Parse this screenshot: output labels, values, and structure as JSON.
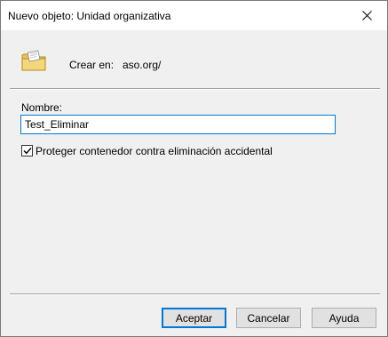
{
  "window": {
    "title": "Nuevo objeto: Unidad organizativa",
    "close_icon": "close-icon"
  },
  "create": {
    "label": "Crear en:",
    "path": "aso.org/",
    "icon": "organizational-unit-folder-icon"
  },
  "form": {
    "name_label": "Nombre:",
    "name_value": "Test_Eliminar",
    "protect_checkbox": {
      "label": "Proteger contenedor contra eliminación accidental",
      "checked": true
    }
  },
  "buttons": {
    "ok": "Aceptar",
    "cancel": "Cancelar",
    "help": "Ayuda"
  },
  "colors": {
    "accent": "#0078d7",
    "dialog_bg": "#f0f0f0",
    "titlebar_bg": "#ffffff"
  }
}
